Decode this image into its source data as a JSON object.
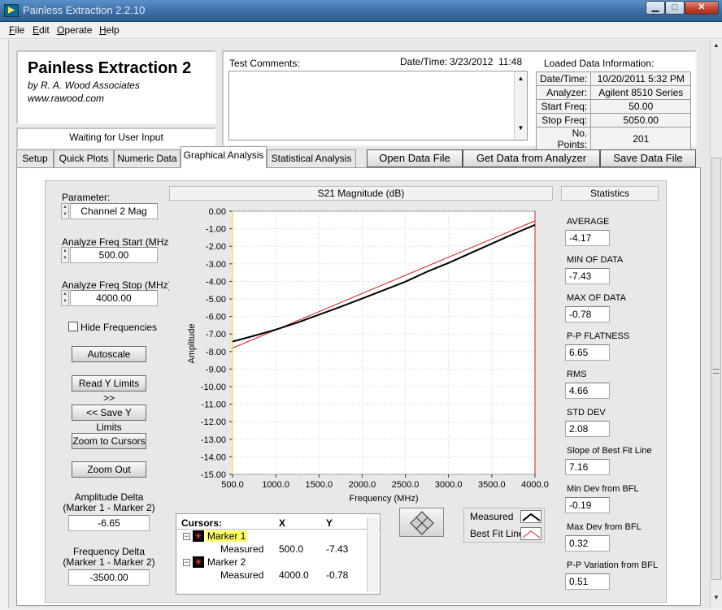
{
  "window": {
    "title": "Painless Extraction 2.2.10",
    "min_glyph": "▁",
    "max_glyph": "□",
    "close_glyph": "✕",
    "icon_glyph": "▶"
  },
  "menu": {
    "items": [
      "File",
      "Edit",
      "Operate",
      "Help"
    ]
  },
  "logo": {
    "title": "Painless Extraction 2",
    "byline": "by R. A. Wood Associates",
    "url": "www.rawood.com"
  },
  "status": "Waiting for User Input",
  "comments": {
    "label": "Test Comments:",
    "value": "",
    "datetime_label": "Date/Time:",
    "datetime_date": "3/23/2012",
    "datetime_time": "11:48"
  },
  "loaded": {
    "title": "Loaded Data Information:",
    "rows": [
      {
        "key": "Date/Time:",
        "value": "10/20/2011 5:32 PM"
      },
      {
        "key": "Analyzer:",
        "value": "Agilent 8510 Series"
      },
      {
        "key": "Start Freq:",
        "value": "50.00"
      },
      {
        "key": "Stop Freq:",
        "value": "5050.00"
      },
      {
        "key": "No. Points:",
        "value": "201"
      }
    ]
  },
  "tabs": [
    "Setup",
    "Quick Plots",
    "Numeric Data",
    "Graphical Analysis",
    "Statistical Analysis"
  ],
  "actions": [
    "Open Data File",
    "Get Data from Analyzer",
    "Save Data File"
  ],
  "controls": {
    "parameter_label": "Parameter:",
    "parameter_value": "Channel 2 Mag",
    "start_label": "Analyze Freq Start (MHz)",
    "start_value": "500.00",
    "stop_label": "Analyze Freq Stop (MHz)",
    "stop_value": "4000.00",
    "hide_freq_label": "Hide Frequencies",
    "hide_freq_checked": false,
    "buttons": [
      "Autoscale",
      "Read Y Limits >>",
      "<< Save Y Limits",
      "Zoom to Cursors",
      "Zoom Out"
    ],
    "amp_delta_label1": "Amplitude Delta",
    "amp_delta_label2": "(Marker 1 - Marker 2)",
    "amp_delta_value": "-6.65",
    "freq_delta_label1": "Frequency Delta",
    "freq_delta_label2": "(Marker 1 - Marker 2)",
    "freq_delta_value": "-3500.00"
  },
  "graph": {
    "title": "S21 Magnitude (dB)"
  },
  "chart_data": {
    "type": "line",
    "title": "S21 Magnitude (dB)",
    "xlabel": "Frequency (MHz)",
    "ylabel": "Amplitude",
    "xlim": [
      500,
      4000
    ],
    "ylim": [
      -15,
      0
    ],
    "x_ticks": [
      "500.0",
      "1000.0",
      "1500.0",
      "2000.0",
      "2500.0",
      "3000.0",
      "3500.0",
      "4000.0"
    ],
    "y_ticks": [
      "0.00",
      "-1.00",
      "-2.00",
      "-3.00",
      "-4.00",
      "-5.00",
      "-6.00",
      "-7.00",
      "-8.00",
      "-9.00",
      "-10.00",
      "-11.00",
      "-12.00",
      "-13.00",
      "-14.00",
      "-15.00"
    ],
    "grid": true,
    "series": [
      {
        "name": "Measured",
        "color": "#000000",
        "x": [
          500,
          750,
          1000,
          1250,
          1500,
          1750,
          2000,
          2250,
          2500,
          2750,
          3000,
          3250,
          3500,
          3750,
          4000
        ],
        "y": [
          -7.43,
          -7.1,
          -6.75,
          -6.35,
          -5.9,
          -5.45,
          -4.98,
          -4.5,
          -4.02,
          -3.45,
          -2.95,
          -2.4,
          -1.85,
          -1.3,
          -0.78
        ]
      },
      {
        "name": "Best Fit Line",
        "color": "#cc2222",
        "x": [
          500,
          4000
        ],
        "y": [
          -7.8,
          -0.55
        ]
      }
    ],
    "legend": "bottom-right"
  },
  "statistics": {
    "title": "Statistics",
    "items": [
      {
        "label": "AVERAGE",
        "value": "-4.17"
      },
      {
        "label": "MIN OF DATA",
        "value": "-7.43"
      },
      {
        "label": "MAX OF DATA",
        "value": "-0.78"
      },
      {
        "label": "P-P FLATNESS",
        "value": "6.65"
      },
      {
        "label": "RMS",
        "value": "4.66"
      },
      {
        "label": "STD DEV",
        "value": "2.08"
      },
      {
        "label": "Slope of Best Fit Line",
        "value": "7.16"
      },
      {
        "label": "Min Dev from BFL",
        "value": "-0.19"
      },
      {
        "label": "Max Dev from BFL",
        "value": "0.32"
      },
      {
        "label": "P-P Variation from BFL",
        "value": "0.51"
      }
    ]
  },
  "cursors": {
    "header": "Cursors:",
    "col_x": "X",
    "col_y": "Y",
    "marker1": "Marker 1",
    "marker1_sub": "Measured",
    "marker1_x": "500.0",
    "marker1_y": "-7.43",
    "marker2": "Marker 2",
    "marker2_sub": "Measured",
    "marker2_x": "4000.0",
    "marker2_y": "-0.78"
  },
  "legend": {
    "measured": "Measured",
    "bestfit": "Best Fit Line"
  }
}
